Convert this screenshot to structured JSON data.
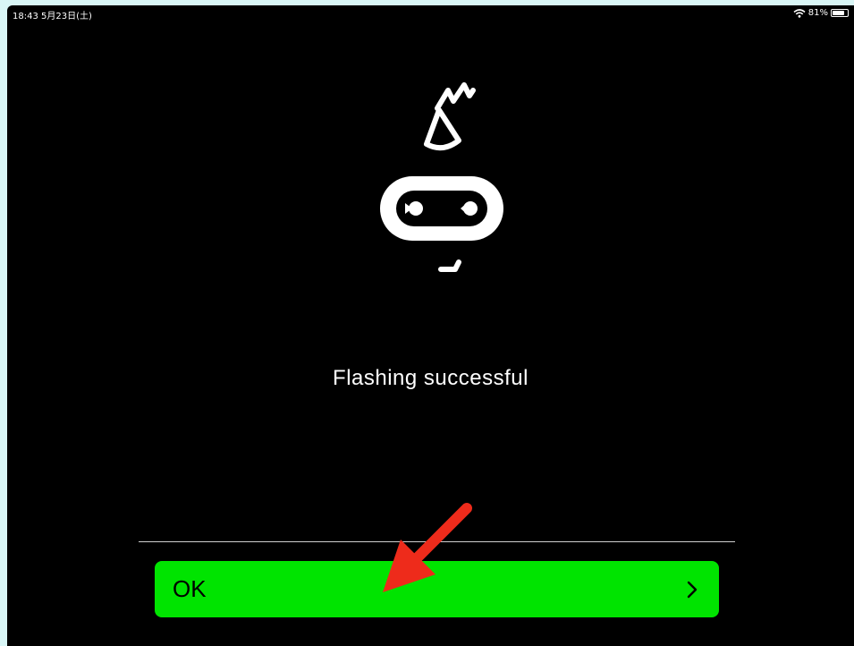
{
  "status_bar": {
    "time_date": "18:43  5月23日(土)",
    "battery": "81%",
    "battery_level": 0.81
  },
  "message": "Flashing successful",
  "button": {
    "label": "OK",
    "chevron": "chevron-right-icon"
  },
  "colors": {
    "background": "#000000",
    "button": "#00e400",
    "annotation_arrow": "#ee2b1b"
  }
}
